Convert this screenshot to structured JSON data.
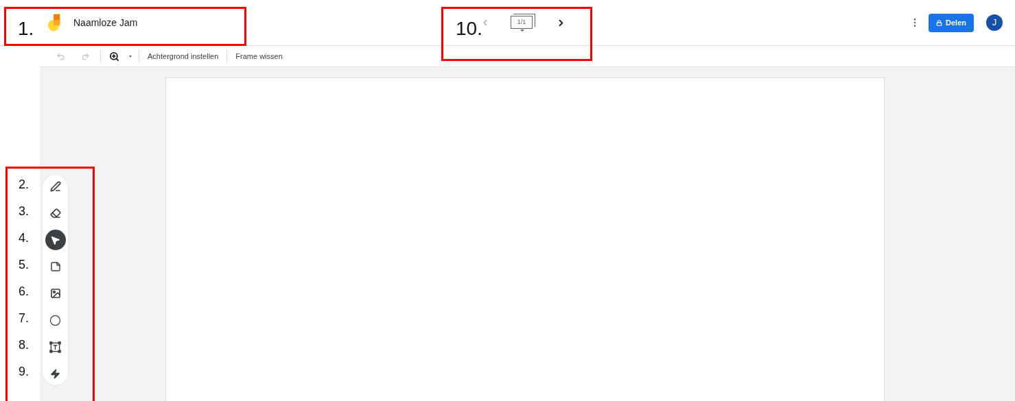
{
  "header": {
    "title": "Naamloze Jam",
    "frame_counter": "1/1",
    "share_button": "Delen",
    "avatar": "J"
  },
  "toolbar": {
    "undo_disabled": true,
    "redo_disabled": true,
    "actions": [
      "Achtergrond instellen",
      "Frame wissen"
    ]
  },
  "tools": [
    {
      "kind": "pen",
      "selected": false
    },
    {
      "kind": "eraser",
      "selected": false
    },
    {
      "kind": "select",
      "selected": true
    },
    {
      "kind": "note",
      "selected": false
    },
    {
      "kind": "image",
      "selected": false
    },
    {
      "kind": "shape",
      "selected": false
    },
    {
      "kind": "textbox",
      "selected": false
    },
    {
      "kind": "laser",
      "selected": false
    }
  ],
  "annotations": {
    "title_label": "1.",
    "frames_label": "10.",
    "tool_labels": [
      "2.",
      "3.",
      "4.",
      "5.",
      "6.",
      "7.",
      "8.",
      "9."
    ]
  }
}
